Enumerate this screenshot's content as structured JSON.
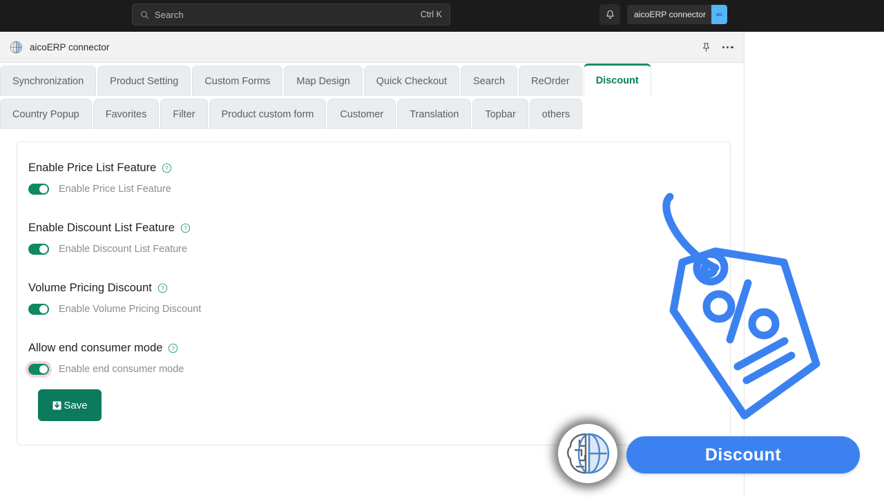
{
  "topbar": {
    "search": {
      "placeholder": "Search",
      "shortcut": "Ctrl K",
      "icon": "search-icon"
    },
    "notification_icon": "bell-icon",
    "account": {
      "name": "aicoERP connector",
      "avatar_text": "aic"
    }
  },
  "app_header": {
    "title": "aicoERP connector",
    "logo_icon": "brain-globe-icon",
    "pin_icon": "pin-icon",
    "more_icon": "ellipsis-icon"
  },
  "tabs": {
    "row1": [
      {
        "label": "Synchronization",
        "active": false
      },
      {
        "label": "Product Setting",
        "active": false
      },
      {
        "label": "Custom Forms",
        "active": false
      },
      {
        "label": "Map Design",
        "active": false
      },
      {
        "label": "Quick Checkout",
        "active": false
      },
      {
        "label": "Search",
        "active": false
      },
      {
        "label": "ReOrder",
        "active": false
      },
      {
        "label": "Discount",
        "active": true
      }
    ],
    "row2": [
      {
        "label": "Country Popup",
        "active": false
      },
      {
        "label": "Favorites",
        "active": false
      },
      {
        "label": "Filter",
        "active": false
      },
      {
        "label": "Product custom form",
        "active": false
      },
      {
        "label": "Customer",
        "active": false
      },
      {
        "label": "Translation",
        "active": false
      },
      {
        "label": "Topbar",
        "active": false
      },
      {
        "label": "others",
        "active": false
      }
    ]
  },
  "settings": {
    "groups": [
      {
        "title": "Enable Price List Feature",
        "help_icon": "question-circle-icon",
        "toggle_label": "Enable Price List Feature",
        "toggle_on": true,
        "focused": false
      },
      {
        "title": "Enable Discount List Feature",
        "help_icon": "question-circle-icon",
        "toggle_label": "Enable Discount List Feature",
        "toggle_on": true,
        "focused": false
      },
      {
        "title": "Volume Pricing Discount",
        "help_icon": "question-circle-icon",
        "toggle_label": "Enable Volume Pricing Discount",
        "toggle_on": true,
        "focused": false
      },
      {
        "title": "Allow end consumer mode",
        "help_icon": "question-circle-icon",
        "toggle_label": "Enable end consumer mode",
        "toggle_on": true,
        "focused": true
      }
    ],
    "save_button": {
      "label": "Save",
      "icon": "save-disk-icon"
    }
  },
  "overlay": {
    "tag_icon": "discount-tag-percent-icon",
    "brand_logo_icon": "brain-globe-icon",
    "badge_label": "Discount"
  },
  "colors": {
    "accent_green": "#0e8c66",
    "save_green": "#0c7a5c",
    "brand_blue": "#3b82f0",
    "topbar_dark": "#1b1b1b",
    "tab_inactive": "#e9edef",
    "focus_ring": "#f9d3d6"
  }
}
